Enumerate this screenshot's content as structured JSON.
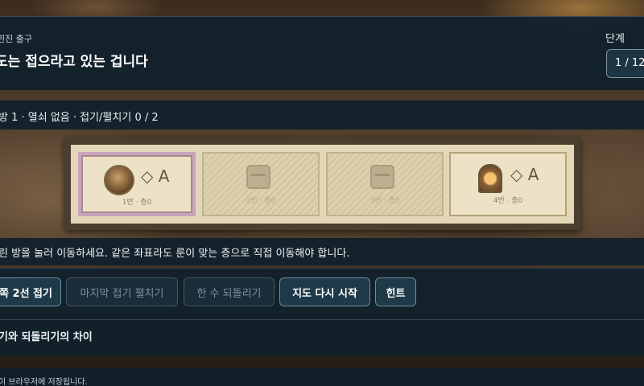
{
  "header": {
    "kicker": "힌진 출구",
    "title": "도는 접으라고 있는 겁니다",
    "stage_label": "단계",
    "stage_value": "1 / 12"
  },
  "status": "방 1 · 열쇠 없음 · 접기/펼치기 0 / 2",
  "map": {
    "rooms": [
      {
        "label": "1번 · 층0",
        "rune": "◇ A",
        "icon": "medallion-icon",
        "state": "current"
      },
      {
        "label": "2번 · 층0",
        "rune": "",
        "icon": "chest-icon",
        "state": "folded"
      },
      {
        "label": "3번 · 층0",
        "rune": "",
        "icon": "chest-icon",
        "state": "folded"
      },
      {
        "label": "4번 · 층0",
        "rune": "◇ A",
        "icon": "door-icon",
        "state": "open"
      }
    ]
  },
  "instruction": "린 방을 눌러 이동하세요. 같은 좌표라도 룬이 맞는 층으로 직접 이동해야 합니다.",
  "controls": {
    "fold": "쪽 2선 접기",
    "unfold": "마지막 접기 펼치기",
    "undo": "한 수 되돌리기",
    "restart": "지도 다시 시작",
    "hint": "힌트"
  },
  "details": {
    "summary": "기와 되돌리기의 차이"
  },
  "footer": "이 브라우저에 저장됩니다.",
  "colors": {
    "panel": "#10202c",
    "accent_border": "#6f8e9e",
    "parchment": "#e3d7b7",
    "current_room": "#c9a4bb"
  }
}
